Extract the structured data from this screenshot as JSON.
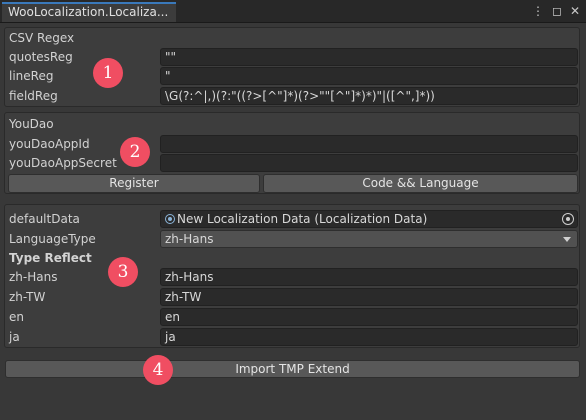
{
  "window": {
    "tab_title": "WooLocalization.Localiza...",
    "icons": [
      "more-vert-icon",
      "maximize-icon",
      "close-icon"
    ]
  },
  "csv": {
    "section_label": "CSV Regex",
    "quotes_label": "quotesReg",
    "quotes_value": "\"\"",
    "line_label": "lineReg",
    "line_value": "\"",
    "field_label": "fieldReg",
    "field_value": "\\G(?:^|,)(?:\"((?>[^\"]*)(?>\"\"[^\"]*)*)\"|([^\",]*))"
  },
  "youdao": {
    "section_label": "YouDao",
    "appid_label": "youDaoAppId",
    "appid_value": "",
    "secret_label": "youDaoAppSecret",
    "secret_value": "",
    "register_label": "Register",
    "code_label": "Code && Language"
  },
  "data": {
    "default_label": "defaultData",
    "default_value": "New Localization Data (Localization Data)",
    "language_type_label": "LanguageType",
    "language_type_value": "zh-Hans",
    "type_reflect_label": "Type Reflect",
    "rows": [
      {
        "label": "zh-Hans",
        "value": "zh-Hans"
      },
      {
        "label": "zh-TW",
        "value": "zh-TW"
      },
      {
        "label": "en",
        "value": "en"
      },
      {
        "label": "ja",
        "value": "ja"
      }
    ]
  },
  "import_label": "Import TMP Extend",
  "badges": [
    "1",
    "2",
    "3",
    "4"
  ],
  "colors": {
    "badge": "#f04e62",
    "accent": "#3a79bb"
  }
}
